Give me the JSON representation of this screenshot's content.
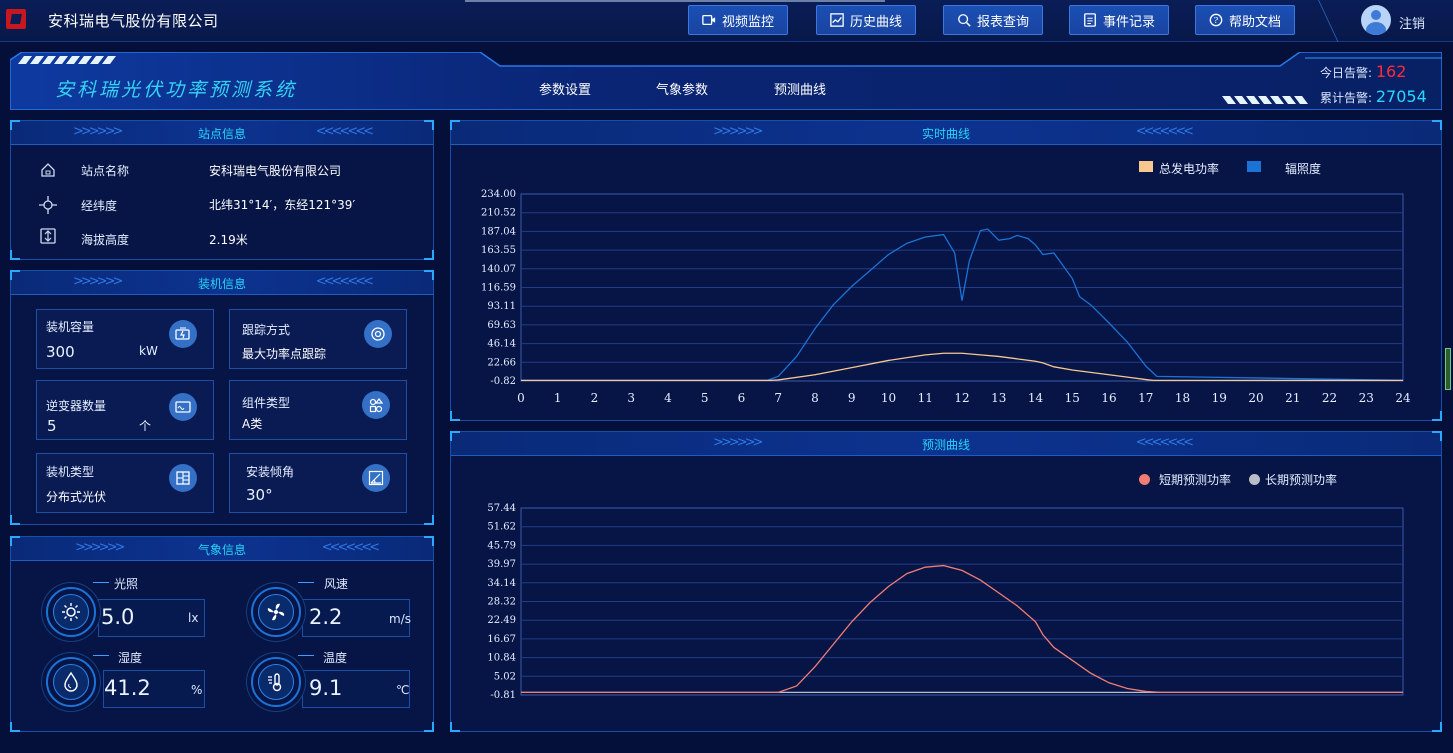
{
  "app": {
    "company": "安科瑞电气股份有限公司",
    "system_title": "安科瑞光伏功率预测系统",
    "logout": "注销"
  },
  "nav": [
    "视频监控",
    "历史曲线",
    "报表查询",
    "事件记录",
    "帮助文档"
  ],
  "tabs": [
    "参数设置",
    "气象参数",
    "预测曲线"
  ],
  "alarms": {
    "today_label": "今日告警:",
    "today_value": "162",
    "total_label": "累计告警:",
    "total_value": "27054"
  },
  "site": {
    "title": "站点信息",
    "rows": [
      {
        "label": "站点名称",
        "value": "安科瑞电气股份有限公司",
        "icon": "home-icon"
      },
      {
        "label": "经纬度",
        "value": "北纬31°14′，东经121°39′",
        "icon": "crosshair-icon"
      },
      {
        "label": "海拔高度",
        "value": "2.19米",
        "icon": "altitude-icon"
      }
    ]
  },
  "install": {
    "title": "装机信息",
    "cards": [
      {
        "label": "装机容量",
        "value": "300",
        "unit": "kW",
        "icon": "battery-icon"
      },
      {
        "label": "跟踪方式",
        "value": "最大功率点跟踪",
        "unit": "",
        "icon": "target-icon"
      },
      {
        "label": "逆变器数量",
        "value": "5",
        "unit": "个",
        "icon": "inverter-icon"
      },
      {
        "label": "组件类型",
        "value": "A类",
        "unit": "",
        "icon": "components-icon"
      },
      {
        "label": "装机类型",
        "value": "分布式光伏",
        "unit": "",
        "icon": "grid-icon"
      },
      {
        "label": "安装倾角",
        "value": "30°",
        "unit": "",
        "icon": "angle-icon"
      }
    ]
  },
  "weather": {
    "title": "气象信息",
    "items": [
      {
        "label": "光照",
        "value": "5.0",
        "unit": "lx",
        "icon": "sun-icon"
      },
      {
        "label": "风速",
        "value": "2.2",
        "unit": "m/s",
        "icon": "fan-icon"
      },
      {
        "label": "湿度",
        "value": "41.2",
        "unit": "%",
        "icon": "humidity-icon"
      },
      {
        "label": "温度",
        "value": "9.1",
        "unit": "℃",
        "icon": "thermometer-icon"
      }
    ]
  },
  "chart_data": [
    {
      "type": "line",
      "title": "实时曲线",
      "yticks": [
        "234.00",
        "210.52",
        "187.04",
        "163.55",
        "140.07",
        "116.59",
        "93.11",
        "69.63",
        "46.14",
        "22.66",
        "-0.82"
      ],
      "ylim": [
        -0.82,
        234.0
      ],
      "xlim": [
        0,
        24
      ],
      "xticks": [
        "0",
        "1",
        "2",
        "3",
        "4",
        "5",
        "6",
        "7",
        "8",
        "9",
        "10",
        "11",
        "12",
        "13",
        "14",
        "15",
        "16",
        "17",
        "18",
        "19",
        "20",
        "21",
        "22",
        "23",
        "24"
      ],
      "legend_position": "top-right",
      "grid": "horizontal",
      "series": [
        {
          "name": "总发电功率",
          "color": "#f6c890",
          "x": [
            0,
            6.8,
            7,
            8,
            9,
            10,
            11,
            11.5,
            12,
            12.5,
            13,
            13.5,
            14,
            14.2,
            14.5,
            15,
            15.5,
            16,
            16.5,
            17,
            17.2,
            24
          ],
          "y": [
            0,
            0,
            0.5,
            7,
            16,
            25,
            32,
            34,
            34,
            32,
            30,
            27,
            24,
            22,
            17,
            13,
            10,
            7,
            4,
            1,
            0,
            0
          ]
        },
        {
          "name": "辐照度",
          "color": "#1b73d6",
          "x": [
            0,
            6.7,
            7,
            7.5,
            8,
            8.5,
            9,
            9.5,
            10,
            10.5,
            11,
            11.5,
            11.8,
            12,
            12.2,
            12.5,
            12.7,
            13,
            13.3,
            13.5,
            13.8,
            14,
            14.2,
            14.5,
            15,
            15.2,
            15.5,
            16,
            16.5,
            17,
            17.3,
            24
          ],
          "y": [
            0,
            0,
            5,
            30,
            65,
            95,
            118,
            138,
            158,
            172,
            180,
            183,
            160,
            100,
            150,
            188,
            190,
            176,
            178,
            182,
            178,
            170,
            158,
            160,
            128,
            105,
            95,
            72,
            48,
            18,
            5,
            0
          ]
        }
      ]
    },
    {
      "type": "line",
      "title": "预测曲线",
      "yticks": [
        "57.44",
        "51.62",
        "45.79",
        "39.97",
        "34.14",
        "28.32",
        "22.49",
        "16.67",
        "10.84",
        "5.02",
        "-0.81"
      ],
      "ylim": [
        -0.81,
        57.44
      ],
      "xlim": [
        0,
        24
      ],
      "legend_position": "top-right",
      "grid": "horizontal",
      "series": [
        {
          "name": "短期预测功率",
          "color": "#f07d74",
          "x": [
            0,
            7,
            7.5,
            8,
            8.5,
            9,
            9.5,
            10,
            10.5,
            11,
            11.5,
            12,
            12.5,
            13,
            13.5,
            14,
            14.2,
            14.5,
            15,
            15.5,
            16,
            16.5,
            17,
            17.4,
            24
          ],
          "y": [
            0,
            0,
            2,
            8,
            15,
            22,
            28,
            33,
            37,
            39,
            39.5,
            38,
            35,
            31,
            27,
            22,
            18,
            14,
            10,
            6,
            3,
            1.2,
            0.3,
            0,
            0
          ]
        },
        {
          "name": "长期预测功率",
          "color": "#b9bec8",
          "x": [
            0,
            24
          ],
          "y": [
            0,
            0
          ]
        }
      ]
    }
  ]
}
